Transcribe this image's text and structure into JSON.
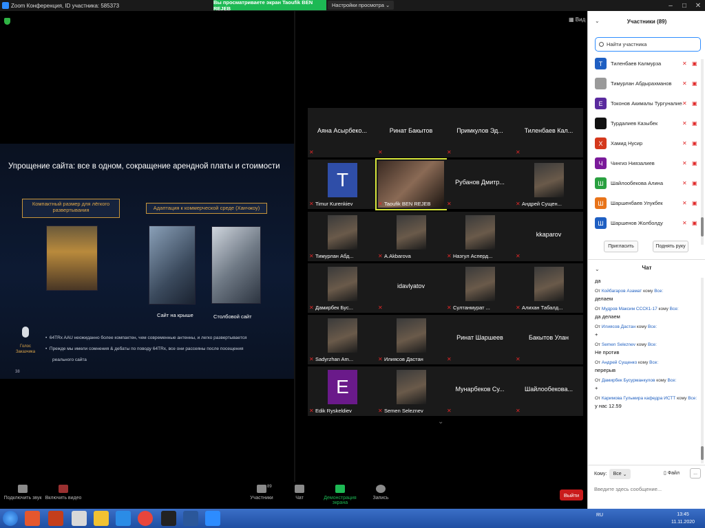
{
  "window": {
    "title": "Zoom Конференция, ID участника: 585373",
    "share_banner": "Вы просматриваете экран Taoufik BEN REJEB",
    "view_options": "Настройки просмотра ⌄",
    "view_button": "Вид"
  },
  "slide": {
    "title": "Упрощение сайта: все в одном, сокращение арендной платы и стоимости",
    "box_left": "Компактный размер для лёгкого развертывания",
    "box_right": "Адаптация к коммерческой среде (Ханчжоу)",
    "caption_roof": "Сайт на крыше",
    "caption_pole": "Столбовой сайт",
    "voice_label": "Голос Заказчика",
    "bullet1": "64TRx AAU неожиданно более компактен, чем современные антенны, и легко развертывается",
    "bullet2": "Прежде мы имели сомнения & дебаты по поводу 64TRx, все они рассеяны после посещения",
    "bullet2b": "реального сайта",
    "page_number": "38"
  },
  "gallery": {
    "tiles": [
      {
        "name": "Аяна Асырбеко...",
        "label": ""
      },
      {
        "name": "Ринат Бакытов",
        "label": ""
      },
      {
        "name": "Примкулов Эд...",
        "label": ""
      },
      {
        "name": "Тиленбаев Кал...",
        "label": ""
      },
      {
        "name": "",
        "label": "Timur Kurenkiev",
        "avatar": "T",
        "color": "#2f4ea8"
      },
      {
        "name": "",
        "label": "Taoufik BEN REJEB",
        "active": true
      },
      {
        "name": "Рубанов Дмитр...",
        "label": ""
      },
      {
        "name": "",
        "label": "Андрей Сущен..."
      },
      {
        "name": "",
        "label": "Тимурлан Абд..."
      },
      {
        "name": "",
        "label": "A.Akbarova"
      },
      {
        "name": "",
        "label": "Назгул Асперд..."
      },
      {
        "name": "kkaparov",
        "label": ""
      },
      {
        "name": "",
        "label": "Дамирбек Бус..."
      },
      {
        "name": "idavlyatov",
        "label": ""
      },
      {
        "name": "",
        "label": "Султанмурат ..."
      },
      {
        "name": "",
        "label": "Алихан Табалд..."
      },
      {
        "name": "",
        "label": "Sadyrzhan Am..."
      },
      {
        "name": "",
        "label": "Илиясов Дастан"
      },
      {
        "name": "Ринат Шаршеев",
        "label": ""
      },
      {
        "name": "Бакытов Улан",
        "label": ""
      },
      {
        "name": "",
        "label": "Edik Ryskeldiev",
        "avatar": "E",
        "color": "#6a1a8a"
      },
      {
        "name": "",
        "label": "Semen Seleznev"
      },
      {
        "name": "Мунарбеков Су...",
        "label": ""
      },
      {
        "name": "Шайлообекова...",
        "label": ""
      }
    ]
  },
  "toolbar": {
    "audio": "Подключить звук",
    "video": "Включить видео",
    "participants": "Участники",
    "participants_count": "89",
    "chat": "Чат",
    "share": "Демонстрация экрана",
    "record": "Запись",
    "leave": "Выйти"
  },
  "participants_panel": {
    "title": "Участники (89)",
    "search_placeholder": "Найти участника",
    "invite": "Пригласить",
    "raise_hand": "Поднять руку",
    "list": [
      {
        "initial": "T",
        "name": "Тиленбаев Калмурза",
        "color": "#1f5fc2"
      },
      {
        "initial": "",
        "name": "Тимурлан Абдырахманов",
        "color": "#9a9a9a"
      },
      {
        "initial": "E",
        "name": "Токонов Акималы Тургуналиев...",
        "color": "#5a2a9e"
      },
      {
        "initial": "",
        "name": "Турдалиев Казыбек",
        "color": "#111111"
      },
      {
        "initial": "Х",
        "name": "Хамид Нусир",
        "color": "#d4381c"
      },
      {
        "initial": "Ч",
        "name": "Чингиз Ниязалиев",
        "color": "#7a1a9a"
      },
      {
        "initial": "Ш",
        "name": "Шайлообекова Алина",
        "color": "#2aa040"
      },
      {
        "initial": "Ш",
        "name": "Шаршенбаев Улукбек",
        "color": "#e8741a"
      },
      {
        "initial": "Ш",
        "name": "Шаршенов Жолболду",
        "color": "#1f5fc2"
      }
    ]
  },
  "chat_panel": {
    "title": "Чат",
    "first_text": "да",
    "messages": [
      {
        "from": "Койбагаров Азамат",
        "to": "Все:",
        "text": "делаем"
      },
      {
        "from": "Мудров Максим СССК1-17",
        "to": "Все:",
        "text": "да делаем"
      },
      {
        "from": "Илиясов Дастан",
        "to": "Все:",
        "text": "+"
      },
      {
        "from": "Semen Seleznev",
        "to": "Все:",
        "text": "Не против"
      },
      {
        "from": "Андрей Сущенко",
        "to": "Все:",
        "text": "перерыв"
      },
      {
        "from": "Дамирбек Бусурманкулов",
        "to": "Все:",
        "text": "+"
      },
      {
        "from": "Каримова Гульмира кафедра ИСТТ",
        "to": "Все:",
        "text": "у нас 12.59"
      }
    ],
    "prefix_from": "От",
    "prefix_to": "кому",
    "to_label": "Кому:",
    "to_value": "Все",
    "file_label": "Файл",
    "more": "...",
    "compose_placeholder": "Введите здесь сообщение..."
  },
  "taskbar": {
    "lang": "RU",
    "time": "13:45",
    "date": "11.11.2020"
  }
}
